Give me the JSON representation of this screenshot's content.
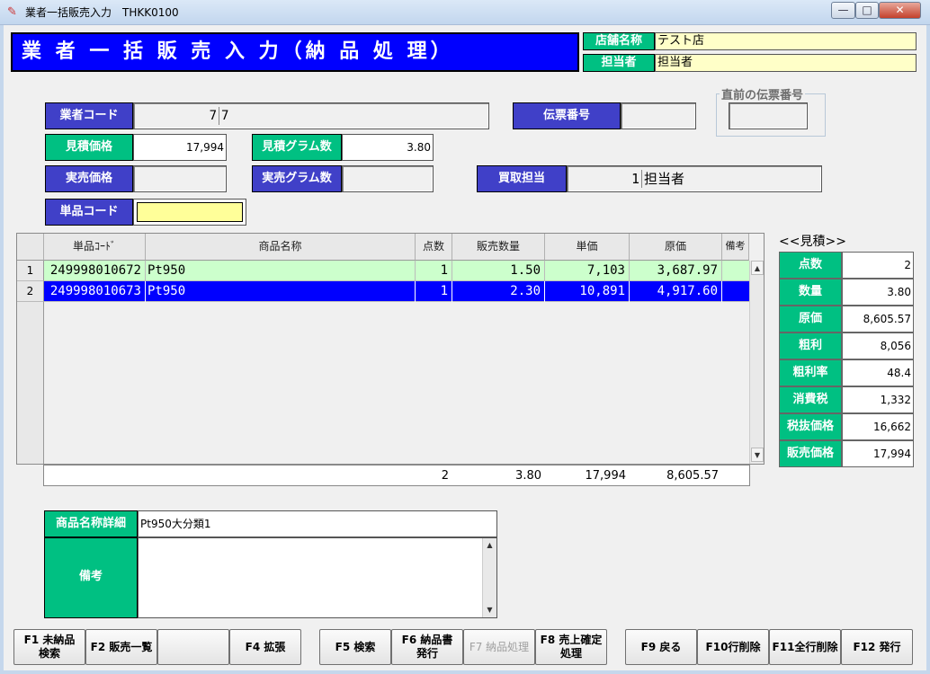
{
  "window": {
    "title": "業者一括販売入力　THKK0100",
    "min": "—",
    "max": "□",
    "close": "✕",
    "app_icon": "app-icon"
  },
  "header": {
    "title": "業 者 一 括 販 売 入 力（納 品 処 理）",
    "store_label": "店舗名称",
    "store_value": "テスト店",
    "staff_label": "担当者",
    "staff_value": "担当者"
  },
  "form": {
    "vendor_code_label": "業者コード",
    "vendor_code_value": "7",
    "vendor_name_value": "7",
    "slip_no_label": "伝票番号",
    "slip_no_value": "",
    "prev_slip_label": "直前の伝票番号",
    "prev_slip_value": "",
    "est_price_label": "見積価格",
    "est_price_value": "17,994",
    "est_gram_label": "見積グラム数",
    "est_gram_value": "3.80",
    "actual_price_label": "実売価格",
    "actual_price_value": "",
    "actual_gram_label": "実売グラム数",
    "actual_gram_value": "",
    "buyer_label": "買取担当",
    "buyer_code": "1",
    "buyer_name": "担当者",
    "item_code_label": "単品コード",
    "item_code_value": ""
  },
  "grid": {
    "headers": [
      "単品ｺｰﾄﾞ",
      "商品名称",
      "点数",
      "販売数量",
      "単価",
      "原価",
      "備考"
    ],
    "rows": [
      {
        "num": "1",
        "code": "249998010672",
        "name": "Pt950",
        "qty": "1",
        "amount": "1.50",
        "unit": "7,103",
        "cost": "3,687.97",
        "note": ""
      },
      {
        "num": "2",
        "code": "249998010673",
        "name": "Pt950",
        "qty": "1",
        "amount": "2.30",
        "unit": "10,891",
        "cost": "4,917.60",
        "note": ""
      }
    ],
    "totals": {
      "qty": "2",
      "amount": "3.80",
      "unit": "17,994",
      "cost": "8,605.57"
    },
    "colors": {
      "row1": "#ccffcc",
      "selected": "#0000ff"
    }
  },
  "summary": {
    "title": "<<見積>>",
    "items": [
      {
        "label": "点数",
        "value": "2"
      },
      {
        "label": "数量",
        "value": "3.80"
      },
      {
        "label": "原価",
        "value": "8,605.57"
      },
      {
        "label": "粗利",
        "value": "8,056"
      },
      {
        "label": "粗利率",
        "value": "48.4"
      },
      {
        "label": "消費税",
        "value": "1,332"
      },
      {
        "label": "税抜価格",
        "value": "16,662"
      },
      {
        "label": "販売価格",
        "value": "17,994"
      }
    ]
  },
  "detail": {
    "name_label": "商品名称詳細",
    "name_value": "Pt950大分類1",
    "note_label": "備考",
    "note_value": ""
  },
  "fkeys": [
    {
      "line1": "F1 未納品",
      "line2": "検索"
    },
    {
      "line1": "F2 販売一覧",
      "line2": ""
    },
    {
      "line1": "",
      "line2": ""
    },
    {
      "line1": "F4 拡張",
      "line2": ""
    },
    {
      "line1": "F5 検索",
      "line2": ""
    },
    {
      "line1": "F6 納品書",
      "line2": "発行"
    },
    {
      "line1": "F7 納品処理",
      "line2": ""
    },
    {
      "line1": "F8 売上確定",
      "line2": "処理"
    },
    {
      "line1": "F9 戻る",
      "line2": ""
    },
    {
      "line1": "F10行削除",
      "line2": ""
    },
    {
      "line1": "F11全行削除",
      "line2": ""
    },
    {
      "line1": "F12 発行",
      "line2": ""
    }
  ],
  "colors": {
    "title_bg": "#0000ff",
    "label_blue": "#4040c8",
    "label_green": "#00c082",
    "highlight": "#ffff99"
  }
}
